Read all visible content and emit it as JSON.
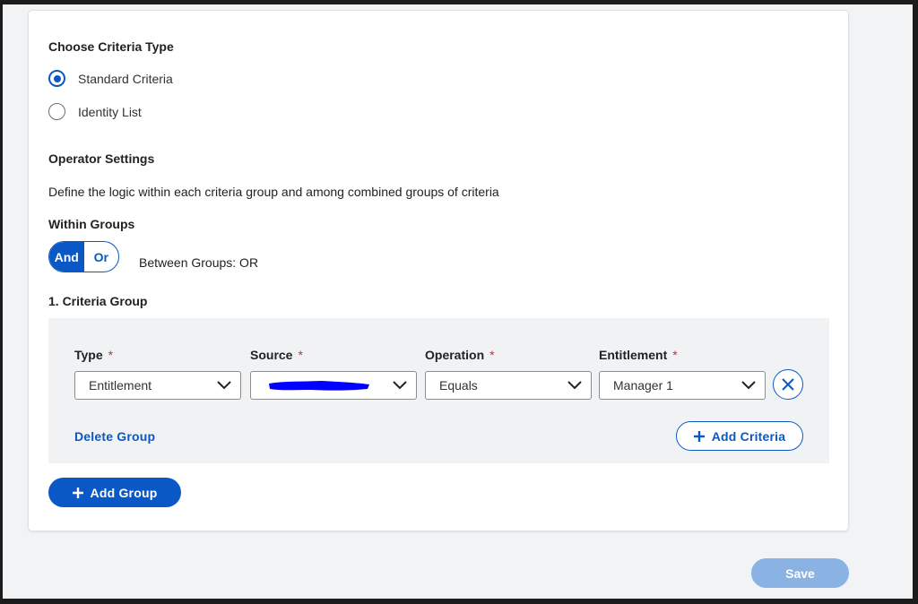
{
  "criteria_type": {
    "heading": "Choose Criteria Type",
    "options": [
      {
        "label": "Standard Criteria",
        "checked": true
      },
      {
        "label": "Identity List",
        "checked": false
      }
    ]
  },
  "operator_settings": {
    "heading": "Operator Settings",
    "description": "Define the logic within each criteria group and among combined groups of criteria",
    "within_groups_label": "Within Groups",
    "toggle": {
      "and_label": "And",
      "or_label": "Or",
      "selected": "And"
    },
    "between_groups_text": "Between Groups: OR"
  },
  "group": {
    "title": "1. Criteria Group",
    "fields": {
      "type": {
        "label": "Type",
        "value": "Entitlement"
      },
      "source": {
        "label": "Source",
        "value": ""
      },
      "operation": {
        "label": "Operation",
        "value": "Equals"
      },
      "entitlement": {
        "label": "Entitlement",
        "value": "Manager 1"
      }
    },
    "required_marker": "*",
    "delete_label": "Delete Group",
    "add_criteria_label": "Add Criteria"
  },
  "add_group_label": "Add Group",
  "save_label": "Save",
  "colors": {
    "accent": "#0a58c6",
    "required": "#c62f3a",
    "save_disabled": "#8ab2e2",
    "redaction": "#0000ff"
  }
}
